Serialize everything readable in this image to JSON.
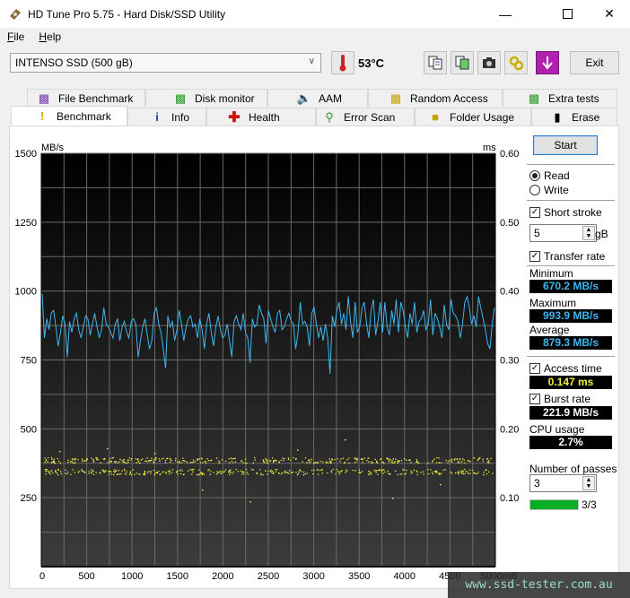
{
  "window": {
    "title": "HD Tune Pro 5.75 - Hard Disk/SSD Utility",
    "controls": [
      "minimize",
      "maximize",
      "close"
    ]
  },
  "menu": {
    "items": [
      {
        "label": "File",
        "accel": "F"
      },
      {
        "label": "Help",
        "accel": "H"
      }
    ]
  },
  "toolbar": {
    "drive": "INTENSO SSD (500 gB)",
    "temperature": "53°C",
    "exit_label": "Exit",
    "icons": [
      "copy-info-icon",
      "copy-screenshot-icon",
      "camera-icon",
      "options-icon",
      "save-down-icon"
    ]
  },
  "tabs": {
    "row1": [
      {
        "label": "File Benchmark",
        "icon": "file-benchmark-icon"
      },
      {
        "label": "Disk monitor",
        "icon": "disk-monitor-icon"
      },
      {
        "label": "AAM",
        "icon": "speaker-icon"
      },
      {
        "label": "Random Access",
        "icon": "random-access-icon"
      },
      {
        "label": "Extra tests",
        "icon": "extra-tests-icon"
      }
    ],
    "row2": [
      {
        "label": "Benchmark",
        "icon": "exclamation-icon",
        "active": true
      },
      {
        "label": "Info",
        "icon": "info-icon"
      },
      {
        "label": "Health",
        "icon": "health-cross-icon"
      },
      {
        "label": "Error Scan",
        "icon": "magnifier-icon"
      },
      {
        "label": "Folder Usage",
        "icon": "folder-icon"
      },
      {
        "label": "Erase",
        "icon": "trash-icon"
      }
    ]
  },
  "controls": {
    "start_label": "Start",
    "mode": {
      "options": [
        "Read",
        "Write"
      ],
      "selected": "Read"
    },
    "short_stroke": {
      "label": "Short stroke",
      "checked": true,
      "value": "5",
      "unit": "gB"
    },
    "transfer_rate": {
      "label": "Transfer rate",
      "checked": true
    },
    "minimum": {
      "label": "Minimum",
      "value": "670.2 MB/s"
    },
    "maximum": {
      "label": "Maximum",
      "value": "993.9 MB/s"
    },
    "average": {
      "label": "Average",
      "value": "879.3 MB/s"
    },
    "access_time": {
      "label": "Access time",
      "checked": true,
      "value": "0.147 ms"
    },
    "burst_rate": {
      "label": "Burst rate",
      "checked": true,
      "value": "221.9 MB/s"
    },
    "cpu_usage": {
      "label": "CPU usage",
      "value": "2.7%"
    },
    "passes": {
      "label": "Number of passes",
      "value": "3",
      "progress_text": "3/3",
      "progress": 1.0
    },
    "colors": {
      "transfer": "#3fb6ee",
      "access": "#f0f040",
      "burst": "#ffffff",
      "progress": "#06b025"
    }
  },
  "chart_data": {
    "type": "line",
    "title": "",
    "xlabel": "mB",
    "ylabel": "MB/s",
    "y2label": "ms",
    "xlim": [
      0,
      5000
    ],
    "ylim": [
      0,
      1500
    ],
    "y2lim": [
      0,
      0.6
    ],
    "x_ticks": [
      "0",
      "500",
      "1000",
      "1500",
      "2000",
      "2500",
      "3000",
      "3500",
      "4000",
      "4500",
      "5000mB"
    ],
    "y_ticks": [
      "1500",
      "1250",
      "1000",
      "750",
      "500",
      "250"
    ],
    "y2_ticks": [
      "0.60",
      "0.50",
      "0.40",
      "0.30",
      "0.20",
      "0.10"
    ],
    "grid": true,
    "series": [
      {
        "name": "Transfer rate (MB/s)",
        "color": "#3fb6ee",
        "summary": {
          "min": 670.2,
          "max": 993.9,
          "avg": 879.3
        },
        "values": [
          990,
          830,
          900,
          860,
          920,
          930,
          870,
          800,
          850,
          910,
          880,
          760,
          890,
          850,
          900,
          920,
          860,
          830,
          870,
          910,
          900,
          840,
          880,
          920,
          870,
          830,
          860,
          940,
          880,
          870,
          850,
          830,
          880,
          900,
          820,
          870,
          890,
          850,
          830,
          890,
          900,
          880,
          760,
          820,
          870,
          900,
          840,
          790,
          820,
          920,
          940,
          880,
          850,
          790,
          720,
          910,
          870,
          890,
          820,
          860,
          930,
          880,
          820,
          870,
          900,
          910,
          870,
          880,
          830,
          900,
          860,
          790,
          880,
          920,
          850,
          800,
          870,
          910,
          860,
          830,
          840,
          880,
          820,
          760,
          890,
          910,
          880,
          860,
          920,
          850,
          830,
          740,
          900,
          870,
          880,
          950,
          920,
          900,
          810,
          930,
          900,
          870,
          850,
          920,
          930,
          860,
          870,
          900,
          920,
          890,
          880,
          790,
          850,
          960,
          880,
          890,
          870,
          800,
          920,
          940,
          880,
          830,
          870,
          820,
          880,
          830,
          700,
          910,
          870,
          930,
          960,
          880,
          920,
          860,
          980,
          890,
          830,
          960,
          850,
          870,
          940,
          960,
          880,
          830,
          930,
          970,
          840,
          890,
          960,
          850,
          960,
          870,
          840,
          930,
          880,
          970,
          850,
          960,
          930,
          870,
          830,
          920,
          880,
          960,
          850,
          890,
          900,
          930,
          860,
          880,
          970,
          840,
          920,
          900,
          870,
          830,
          950,
          880,
          860,
          970,
          920,
          910,
          890,
          830,
          880,
          960,
          980,
          940,
          880,
          910,
          870,
          980,
          940,
          900,
          860,
          810,
          790,
          880,
          940
        ]
      },
      {
        "name": "Access time (ms)",
        "color": "#f0f040",
        "type": "scatter",
        "band_values_ms": [
          0.138,
          0.155
        ],
        "outliers_ms": [
          0.168,
          0.172,
          0.165,
          0.112,
          0.095,
          0.17,
          0.185,
          0.1,
          0.12
        ]
      }
    ]
  }
}
